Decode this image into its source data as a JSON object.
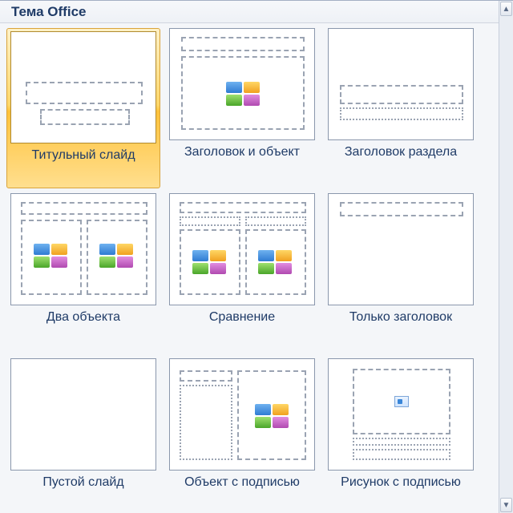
{
  "header": {
    "title": "Тема Office"
  },
  "layouts": [
    {
      "id": "title-slide",
      "label": "Титульный слайд",
      "selected": true
    },
    {
      "id": "title-and-content",
      "label": "Заголовок и объект",
      "selected": false
    },
    {
      "id": "section-header",
      "label": "Заголовок раздела",
      "selected": false
    },
    {
      "id": "two-content",
      "label": "Два объекта",
      "selected": false
    },
    {
      "id": "comparison",
      "label": "Сравнение",
      "selected": false
    },
    {
      "id": "title-only",
      "label": "Только заголовок",
      "selected": false
    },
    {
      "id": "blank",
      "label": "Пустой слайд",
      "selected": false
    },
    {
      "id": "content-with-caption",
      "label": "Объект с подписью",
      "selected": false
    },
    {
      "id": "picture-with-caption",
      "label": "Рисунок с подписью",
      "selected": false
    }
  ],
  "scrollbar": {
    "up_glyph": "▲",
    "down_glyph": "▼"
  }
}
